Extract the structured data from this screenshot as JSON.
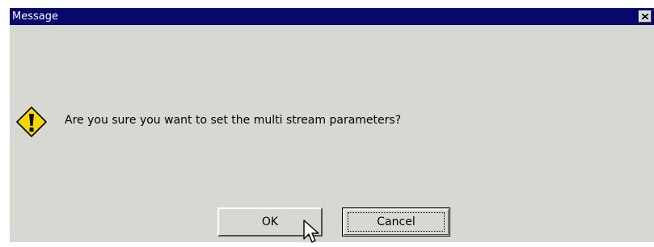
{
  "dialog": {
    "title": "Message",
    "close_symbol": "✕",
    "icon": "warning-icon",
    "message": "Are you sure you want to set the multi stream parameters?",
    "ok_label": "OK",
    "cancel_label": "Cancel",
    "focused_button": "Cancel"
  },
  "colors": {
    "titlebar": "#08086b",
    "title_text": "#ffffff",
    "dialog_bg": "#d8d8d2",
    "warning_fill": "#f5d800",
    "warning_stroke": "#000000"
  }
}
